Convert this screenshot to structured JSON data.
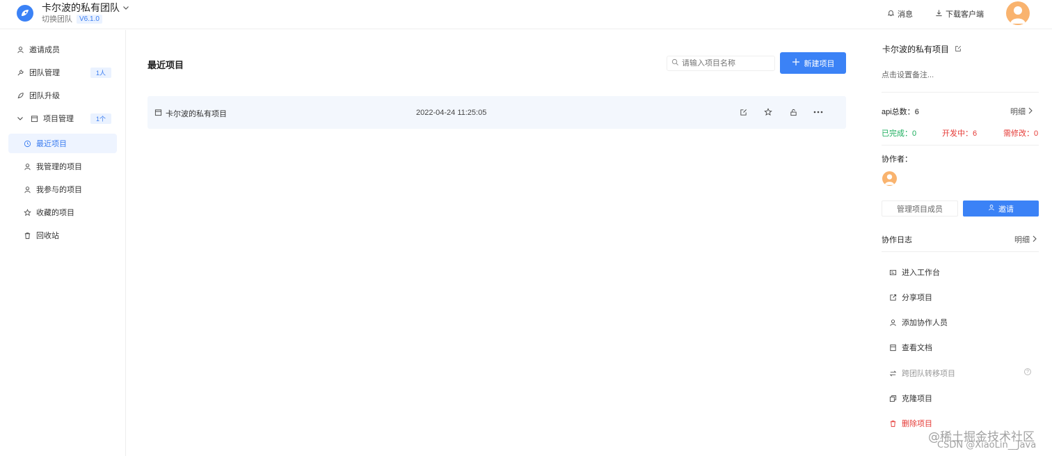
{
  "header": {
    "team_name": "卡尔波的私有团队",
    "switch_label": "切换团队",
    "version": "V6.1.0",
    "messages_label": "消息",
    "download_label": "下载客户端"
  },
  "sidebar": {
    "items": [
      {
        "label": "邀请成员",
        "icon": "user-icon"
      },
      {
        "label": "团队管理",
        "icon": "wrench-icon",
        "badge": "1人"
      },
      {
        "label": "团队升级",
        "icon": "rocket-icon"
      },
      {
        "label": "项目管理",
        "icon": "folder-icon",
        "badge": "1个"
      }
    ],
    "sub_items": [
      {
        "label": "最近项目",
        "icon": "clock-icon",
        "active": true
      },
      {
        "label": "我管理的项目",
        "icon": "user-icon"
      },
      {
        "label": "我参与的项目",
        "icon": "user-icon"
      },
      {
        "label": "收藏的项目",
        "icon": "star-icon"
      },
      {
        "label": "回收站",
        "icon": "trash-icon"
      }
    ]
  },
  "main": {
    "title": "最近项目",
    "search_placeholder": "请输入项目名称",
    "new_button": "新建项目",
    "projects": [
      {
        "name": "卡尔波的私有项目",
        "time": "2022-04-24 11:25:05"
      }
    ]
  },
  "panel": {
    "project_name": "卡尔波的私有项目",
    "note_placeholder": "点击设置备注...",
    "api_total_label": "api总数：",
    "api_total": "6",
    "detail_label": "明细",
    "stats": {
      "done_label": "已完成：",
      "done": "0",
      "dev_label": "开发中：",
      "dev": "6",
      "modify_label": "需修改：",
      "modify": "0"
    },
    "collaborators_label": "协作者：",
    "manage_members": "管理项目成员",
    "invite": "邀请",
    "log_label": "协作日志",
    "actions": [
      {
        "label": "进入工作台",
        "icon": "workspace-icon"
      },
      {
        "label": "分享项目",
        "icon": "share-icon"
      },
      {
        "label": "添加协作人员",
        "icon": "user-icon"
      },
      {
        "label": "查看文档",
        "icon": "document-icon"
      },
      {
        "label": "跨团队转移项目",
        "icon": "transfer-icon",
        "disabled": true
      },
      {
        "label": "克隆项目",
        "icon": "copy-icon"
      },
      {
        "label": "删除项目",
        "icon": "trash-icon",
        "danger": true
      }
    ]
  },
  "watermark": {
    "line1": "@稀土掘金技术社区",
    "line2": "CSDN @XiaoLin__Java"
  },
  "colors": {
    "accent": "#3b82f6",
    "success": "#1aad5c",
    "danger": "#e53935"
  }
}
